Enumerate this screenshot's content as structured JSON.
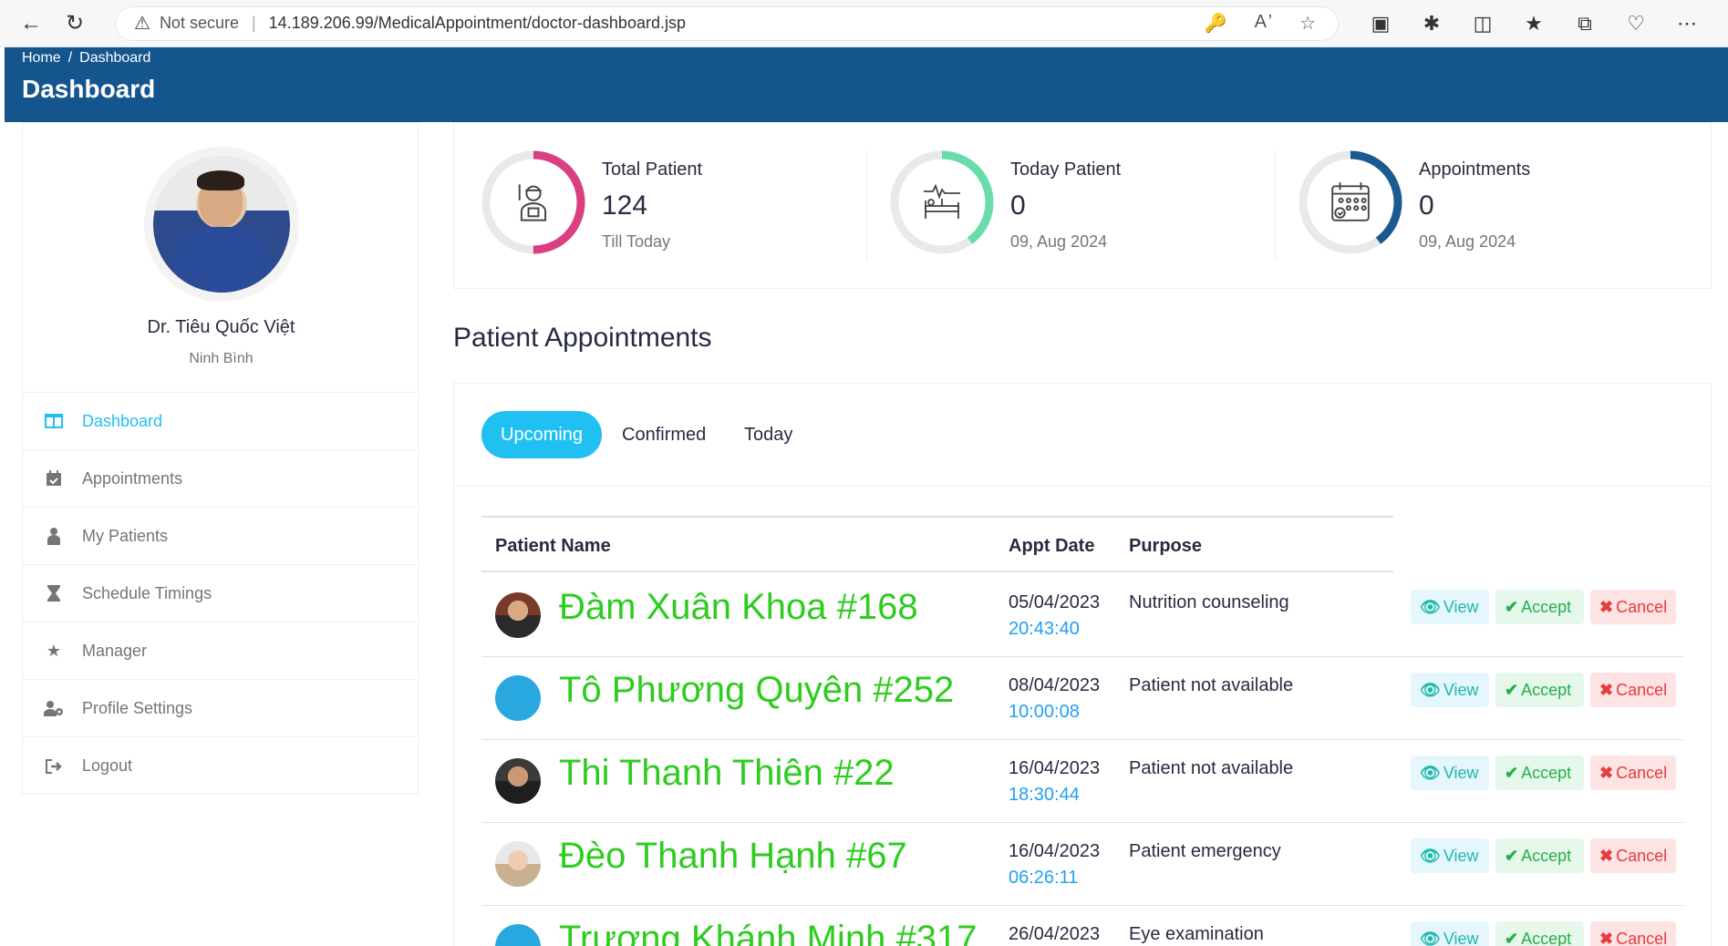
{
  "browser": {
    "security_label": "Not secure",
    "url": "14.189.206.99/MedicalAppointment/doctor-dashboard.jsp"
  },
  "header": {
    "breadcrumb_home": "Home",
    "breadcrumb_sep": "/",
    "breadcrumb_current": "Dashboard",
    "title": "Dashboard"
  },
  "doctor": {
    "name": "Dr. Tiêu Quốc Việt",
    "location": "Ninh Bình"
  },
  "sidebar": {
    "items": [
      {
        "label": "Dashboard",
        "icon": "columns-icon",
        "active": true
      },
      {
        "label": "Appointments",
        "icon": "calendar-icon",
        "active": false
      },
      {
        "label": "My Patients",
        "icon": "patient-icon",
        "active": false
      },
      {
        "label": "Schedule Timings",
        "icon": "hourglass-icon",
        "active": false
      },
      {
        "label": "Manager",
        "icon": "star-icon",
        "active": false
      },
      {
        "label": "Profile Settings",
        "icon": "user-cog-icon",
        "active": false
      },
      {
        "label": "Logout",
        "icon": "sign-out-icon",
        "active": false
      }
    ]
  },
  "stats": [
    {
      "label": "Total Patient",
      "value": "124",
      "sub": "Till Today",
      "color": "#da3f81",
      "progress": 0.5,
      "icon": "patient-icon"
    },
    {
      "label": "Today Patient",
      "value": "0",
      "sub": "09, Aug 2024",
      "color": "#68dda9",
      "progress": 0.4,
      "icon": "hospital-bed-icon"
    },
    {
      "label": "Appointments",
      "value": "0",
      "sub": "09, Aug 2024",
      "color": "#1b5a90",
      "progress": 0.4,
      "icon": "calendar-icon"
    }
  ],
  "appointments": {
    "section_title": "Patient Appointments",
    "tabs": [
      "Upcoming",
      "Confirmed",
      "Today"
    ],
    "columns": [
      "Patient Name",
      "Appt Date",
      "Purpose"
    ],
    "action_labels": {
      "view": "View",
      "accept": "Accept",
      "cancel": "Cancel"
    },
    "rows": [
      {
        "name": "Đàm Xuân Khoa #168",
        "date": "05/04/2023",
        "time": "20:43:40",
        "purpose": "Nutrition counseling"
      },
      {
        "name": "Tô Phương Quyên #252",
        "date": "08/04/2023",
        "time": "10:00:08",
        "purpose": "Patient not available"
      },
      {
        "name": "Thi Thanh Thiên #22",
        "date": "16/04/2023",
        "time": "18:30:44",
        "purpose": "Patient not available"
      },
      {
        "name": "Đèo Thanh Hạnh #67",
        "date": "16/04/2023",
        "time": "06:26:11",
        "purpose": "Patient emergency"
      },
      {
        "name": "Trương Khánh Minh #317",
        "date": "26/04/2023",
        "time": "",
        "purpose": "Eye examination"
      }
    ]
  }
}
